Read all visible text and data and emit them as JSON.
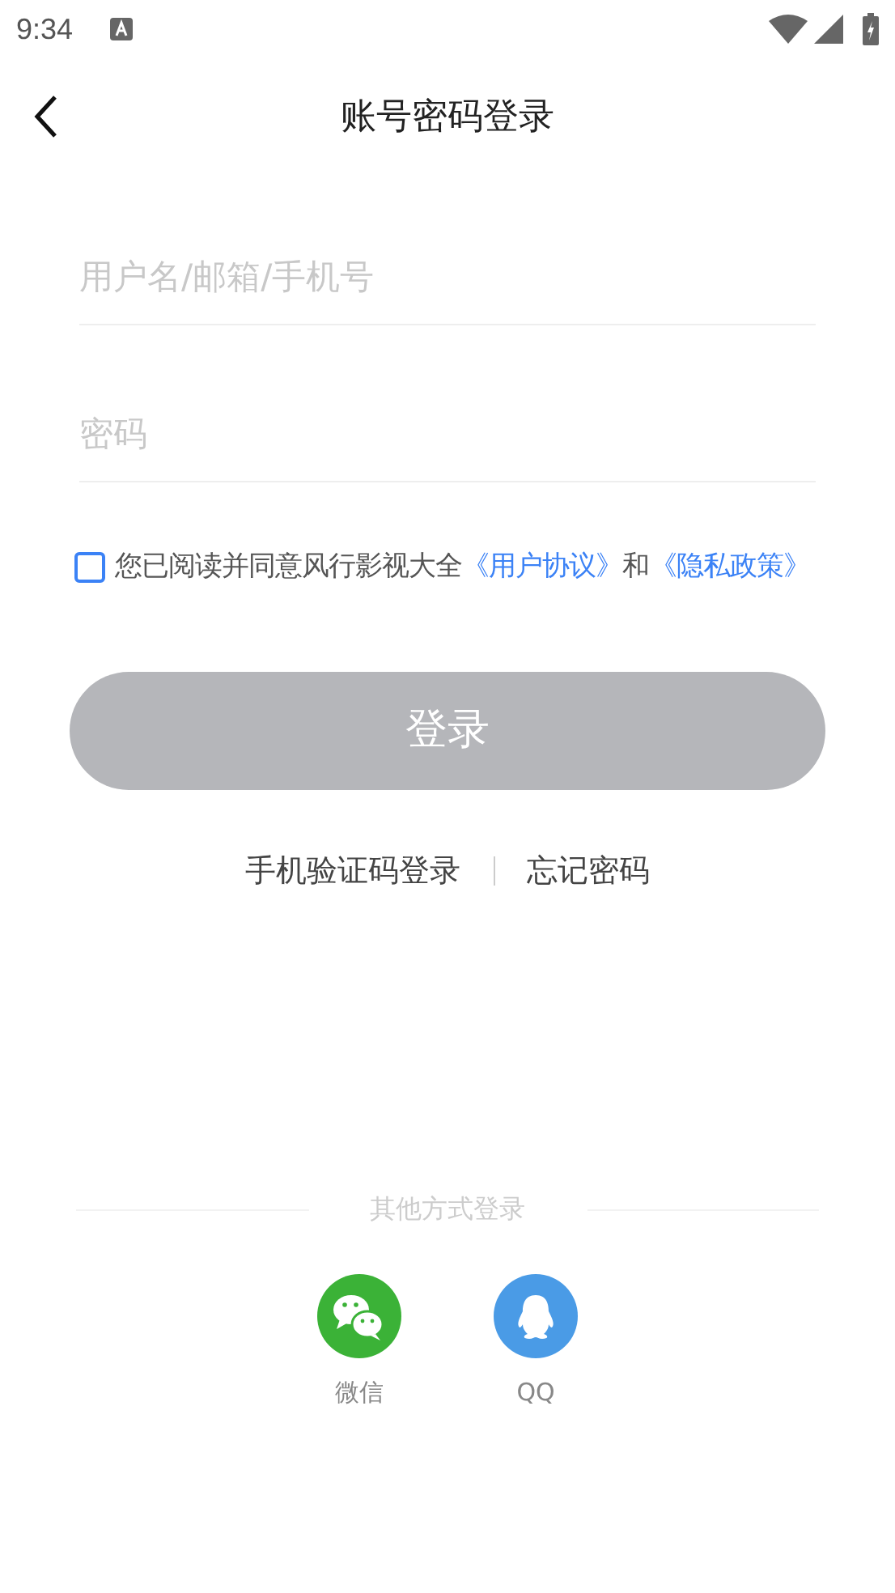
{
  "status_bar": {
    "time": "9:34"
  },
  "header": {
    "title": "账号密码登录"
  },
  "fields": [
    {
      "placeholder": "用户名/邮箱/手机号"
    },
    {
      "placeholder": "密码"
    }
  ],
  "agreement": {
    "checked": false,
    "text": "您已阅读并同意风行影视大全",
    "links": [
      "《用户协议》",
      "《隐私政策》"
    ],
    "conjunction": "和"
  },
  "login_button": {
    "label": "登录",
    "disabled": true
  },
  "alt_links": [
    "手机验证码登录",
    "忘记密码"
  ],
  "other_login": {
    "title": "其他方式登录",
    "options": [
      {
        "kind": "wechat",
        "label": "微信"
      },
      {
        "kind": "qq",
        "label": "QQ"
      }
    ]
  }
}
